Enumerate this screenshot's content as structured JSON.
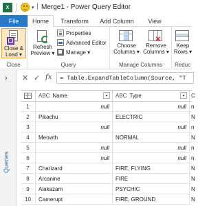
{
  "titlebar": {
    "app_icon_letter": "X",
    "dropdown_glyph": "▾",
    "separator": "|",
    "title": "Merge1 - Power Query Editor"
  },
  "tabs": [
    {
      "label": "File"
    },
    {
      "label": "Home"
    },
    {
      "label": "Transform"
    },
    {
      "label": "Add Column"
    },
    {
      "label": "View"
    }
  ],
  "ribbon": {
    "close_group": {
      "label": "Close",
      "close_load_label_1": "Close &",
      "close_load_label_2": "Load ▾"
    },
    "query_group": {
      "label": "Query",
      "refresh_label_1": "Refresh",
      "refresh_label_2": "Preview ▾",
      "properties_label": "Properties",
      "advanced_editor_label": "Advanced Editor",
      "manage_label": "Manage ▾"
    },
    "manage_columns_group": {
      "label": "Manage Columns",
      "choose_label_1": "Choose",
      "choose_label_2": "Columns ▾",
      "remove_label_1": "Remove",
      "remove_label_2": "Columns ▾"
    },
    "reduce_group": {
      "label": "Reduc",
      "keep_label_1": "Keep",
      "keep_label_2": "Rows ▾"
    }
  },
  "queries_pane": {
    "chevron": "›",
    "label": "Queries"
  },
  "formula_bar": {
    "cancel_glyph": "✕",
    "confirm_glyph": "✓",
    "fx_label": "fx",
    "formula": "= Table.ExpandTableColumn(Source, \"T"
  },
  "grid": {
    "type_badge": "ABC",
    "type_badge_suffix": "C",
    "dropdown_glyph": "▾",
    "columns": [
      {
        "name": "Name"
      },
      {
        "name": "Type"
      },
      {
        "name": ""
      }
    ],
    "rows": [
      {
        "n": "1",
        "name": "null",
        "type": "null",
        "extra": "n",
        "name_null": true,
        "type_null": true
      },
      {
        "n": "2",
        "name": "Pikachu",
        "type": "ELECTRIC",
        "extra": "N",
        "name_null": false,
        "type_null": false
      },
      {
        "n": "3",
        "name": "null",
        "type": "null",
        "extra": "n",
        "name_null": true,
        "type_null": true
      },
      {
        "n": "4",
        "name": "Meowth",
        "type": "NORMAL",
        "extra": "N",
        "name_null": false,
        "type_null": false
      },
      {
        "n": "5",
        "name": "null",
        "type": "null",
        "extra": "n",
        "name_null": true,
        "type_null": true
      },
      {
        "n": "6",
        "name": "null",
        "type": "null",
        "extra": "n",
        "name_null": true,
        "type_null": true
      },
      {
        "n": "7",
        "name": "Charizard",
        "type": "FIRE, FLYING",
        "extra": "N",
        "name_null": false,
        "type_null": false
      },
      {
        "n": "8",
        "name": "Arcanine",
        "type": "FIRE",
        "extra": "N",
        "name_null": false,
        "type_null": false
      },
      {
        "n": "9",
        "name": "Alakazam",
        "type": "PSYCHIC",
        "extra": "N",
        "name_null": false,
        "type_null": false
      },
      {
        "n": "10",
        "name": "Camerupt",
        "type": "FIRE, GROUND",
        "extra": "N",
        "name_null": false,
        "type_null": false
      }
    ]
  },
  "colors": {
    "file_tab": "#2b78c5",
    "excel_green": "#1e7145",
    "close_load_highlight": "#fde9c8",
    "queries_label": "#2b78c5"
  }
}
